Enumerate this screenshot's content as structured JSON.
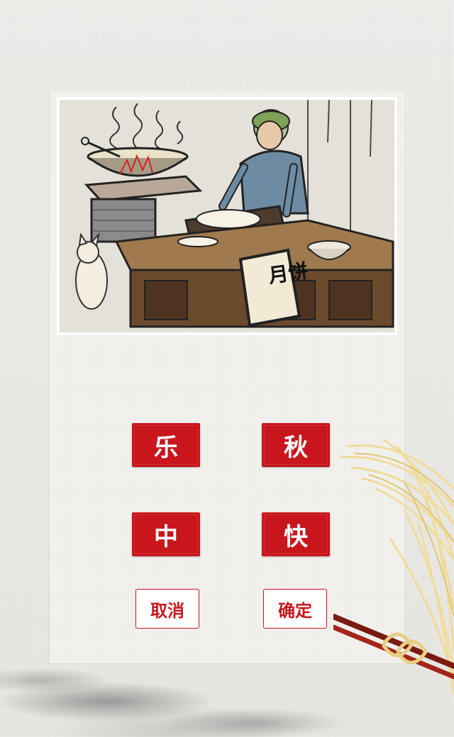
{
  "illustration": {
    "sign_text": "月饼"
  },
  "tiles": [
    {
      "char": "乐"
    },
    {
      "char": "秋"
    },
    {
      "char": "中"
    },
    {
      "char": "快"
    }
  ],
  "actions": {
    "cancel_label": "取消",
    "confirm_label": "确定"
  },
  "colors": {
    "accent": "#c8161c",
    "card_background": "#f3f2ef",
    "page_background": "#e9e7e3"
  }
}
